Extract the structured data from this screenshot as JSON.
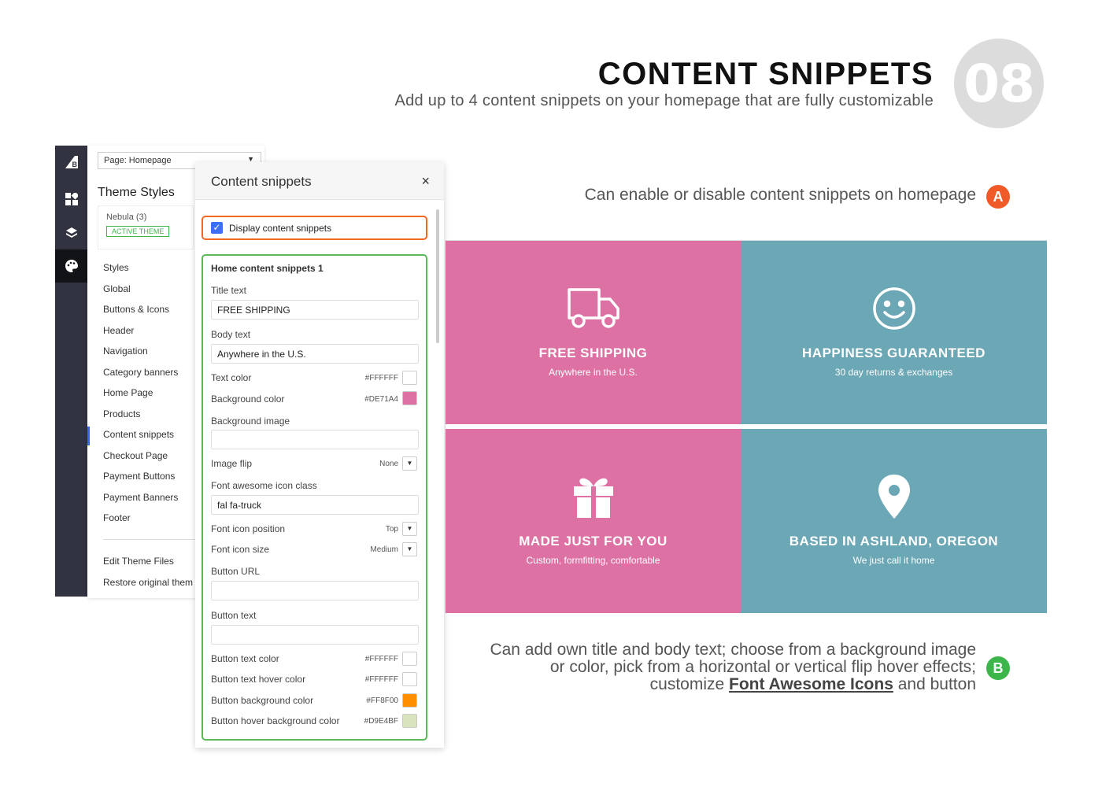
{
  "header": {
    "title": "CONTENT SNIPPETS",
    "subtitle": "Add up to 4 content snippets on your homepage that are fully customizable",
    "number": "08"
  },
  "callouts": {
    "a": {
      "text": "Can enable or disable content snippets on homepage",
      "badge": "A",
      "color": "#f05a28"
    },
    "b": {
      "text_before": "Can add own title and body text; choose from a background image or color, pick from a horizontal or vertical flip hover effects; customize",
      "link": "Font Awesome Icons",
      "text_after": "and button",
      "badge": "B",
      "color": "#3cb64a"
    }
  },
  "rail": {
    "icons": [
      "bigcommerce-logo-icon",
      "dashboard-icon",
      "layers-icon",
      "palette-icon"
    ]
  },
  "theme_panel": {
    "page_select": "Page: Homepage",
    "section_title": "Theme Styles",
    "theme_name": "Nebula (3)",
    "active_badge": "ACTIVE THEME",
    "menu": [
      "Styles",
      "Global",
      "Buttons & Icons",
      "Header",
      "Navigation",
      "Category banners",
      "Home Page",
      "Products",
      "Content snippets",
      "Checkout Page",
      "Payment Buttons",
      "Payment Banners",
      "Footer"
    ],
    "active_item": "Content snippets",
    "menu2": [
      "Edit Theme Files",
      "Restore original them"
    ]
  },
  "snippets_panel": {
    "title": "Content snippets",
    "close": "×",
    "display_label": "Display content snippets",
    "display_checked": true,
    "group_heading": "Home content snippets 1",
    "title_text_label": "Title text",
    "title_text_value": "FREE SHIPPING",
    "body_text_label": "Body text",
    "body_text_value": "Anywhere in the U.S.",
    "text_color_label": "Text color",
    "text_color_value": "#FFFFFF",
    "bg_color_label": "Background color",
    "bg_color_value": "#DE71A4",
    "bg_image_label": "Background image",
    "bg_image_value": "",
    "image_flip_label": "Image flip",
    "image_flip_value": "None",
    "icon_class_label": "Font awesome icon class",
    "icon_class_value": "fal fa-truck",
    "icon_pos_label": "Font icon position",
    "icon_pos_value": "Top",
    "icon_size_label": "Font icon size",
    "icon_size_value": "Medium",
    "button_url_label": "Button URL",
    "button_url_value": "",
    "button_text_label": "Button text",
    "button_text_value": "",
    "btn_text_color_label": "Button text color",
    "btn_text_color_value": "#FFFFFF",
    "btn_hover_color_label": "Button text hover color",
    "btn_hover_color_value": "#FFFFFF",
    "btn_bg_label": "Button background color",
    "btn_bg_value": "#FF8F00",
    "btn_hover_bg_label": "Button hover background color",
    "btn_hover_bg_value": "#D9E4BF"
  },
  "preview": {
    "colors": {
      "pink": "#de71a4",
      "teal": "#6ba7b5"
    },
    "tiles": [
      {
        "icon": "truck-icon",
        "title": "FREE SHIPPING",
        "body": "Anywhere in the U.S."
      },
      {
        "icon": "smile-icon",
        "title": "HAPPINESS GUARANTEED",
        "body": "30 day returns & exchanges"
      },
      {
        "icon": "gift-icon",
        "title": "MADE JUST FOR YOU",
        "body": "Custom, formfitting, comfortable"
      },
      {
        "icon": "map-marker-icon",
        "title": "BASED IN ASHLAND, OREGON",
        "body": "We just call it home"
      }
    ]
  }
}
